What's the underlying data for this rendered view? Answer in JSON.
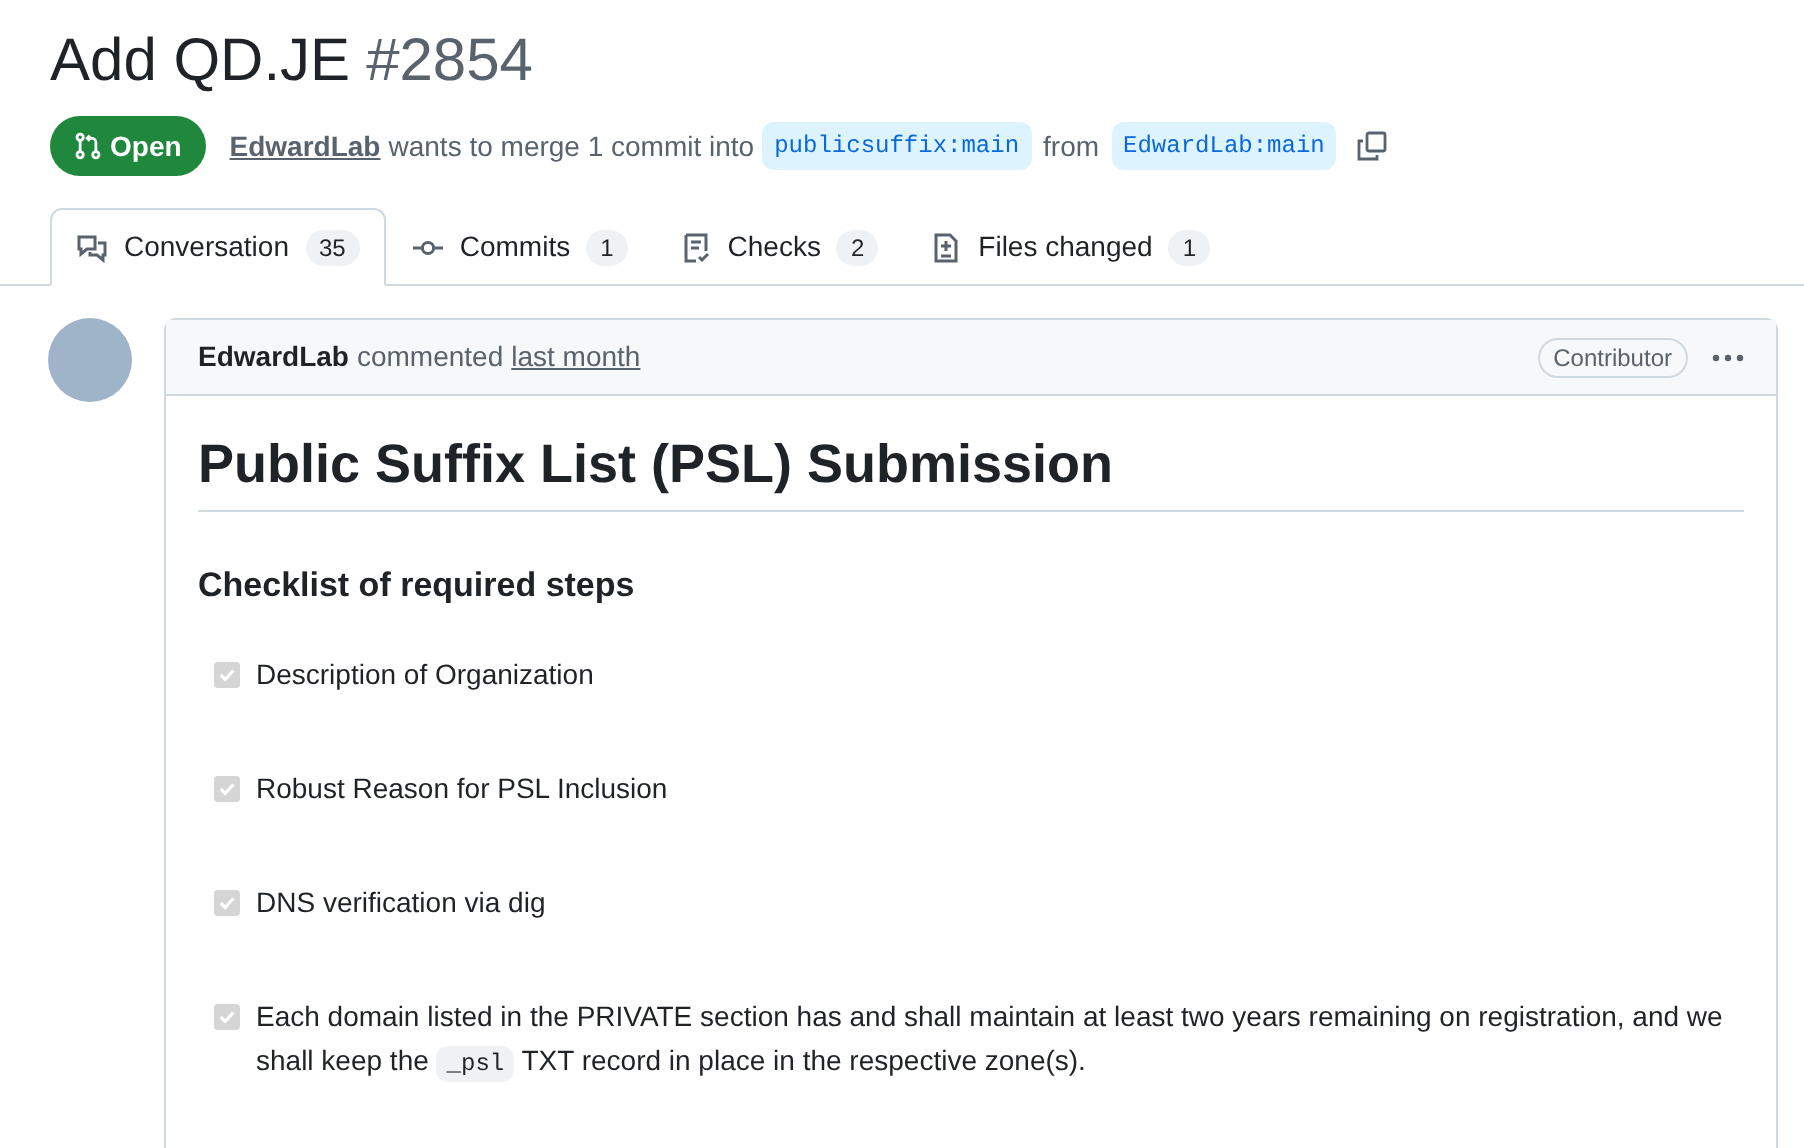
{
  "title": "Add QD.JE",
  "number": "#2854",
  "status": {
    "label": "Open"
  },
  "merge_info": {
    "author": "EdwardLab",
    "text": "wants to merge 1 commit into",
    "base": "publicsuffix:main",
    "from": "from",
    "head": "EdwardLab:main"
  },
  "tabs": [
    {
      "label": "Conversation",
      "count": "35",
      "kind": "conversation",
      "selected": true
    },
    {
      "label": "Commits",
      "count": "1",
      "kind": "commit",
      "selected": false
    },
    {
      "label": "Checks",
      "count": "2",
      "kind": "checks",
      "selected": false
    },
    {
      "label": "Files changed",
      "count": "1",
      "kind": "files",
      "selected": false
    }
  ],
  "comment": {
    "author": "EdwardLab",
    "action": "commented",
    "time": "last month",
    "badge": "Contributor",
    "heading": "Public Suffix List (PSL) Submission",
    "subheading": "Checklist of required steps",
    "checklist": [
      {
        "text": "Description of Organization",
        "checked": true
      },
      {
        "text": "Robust Reason for PSL Inclusion",
        "checked": true
      },
      {
        "text": "DNS verification via dig",
        "checked": true
      },
      {
        "text": "Each domain listed in the PRIVATE section has and shall maintain at least two years remaining on registration, and we shall keep the",
        "code": "_psl",
        "text_after": "TXT record in place in the respective zone(s).",
        "checked": true
      }
    ]
  }
}
